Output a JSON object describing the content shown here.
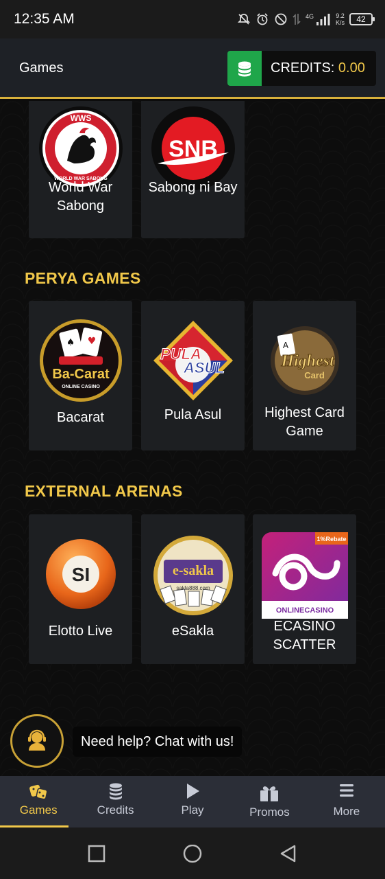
{
  "status_bar": {
    "time": "12:35 AM",
    "network_type": "4G",
    "net_speed_value": "9.2",
    "net_speed_unit": "K/s",
    "battery": "42"
  },
  "header": {
    "title": "Games",
    "credits_label": "CREDITS: ",
    "credits_value": "0.00"
  },
  "sections": {
    "top_games": [
      {
        "label": "World War Sabong",
        "logo_text": "WWS",
        "logo_sub": "WORLD WAR SABONG"
      },
      {
        "label": "Sabong ni Bay",
        "logo_text": "SNB"
      }
    ],
    "perya": {
      "title": "PERYA GAMES",
      "games": [
        {
          "label": "Bacarat",
          "logo_text": "Ba-Carat",
          "logo_sub": "ONLINE CASINO"
        },
        {
          "label": "Pula Asul",
          "logo_text": "PULA",
          "logo_text2": "ASUL"
        },
        {
          "label": "Highest Card Game",
          "logo_text": "Highest",
          "logo_sub": "Card"
        }
      ]
    },
    "external": {
      "title": "EXTERNAL ARENAS",
      "games": [
        {
          "label": "Elotto Live",
          "logo_text": "SI"
        },
        {
          "label": "eSakla",
          "logo_text": "e-sakla",
          "logo_sub": "sakla888.com"
        },
        {
          "label": "ECASINO SCATTER",
          "logo_text": "ONLINECASINO",
          "logo_badge": "1%Rebate"
        }
      ]
    }
  },
  "chat": {
    "prompt": "Need help? Chat with us!"
  },
  "bottom_nav": [
    {
      "label": "Games",
      "icon": "dice-icon",
      "active": true
    },
    {
      "label": "Credits",
      "icon": "coins-icon",
      "active": false
    },
    {
      "label": "Play",
      "icon": "play-icon",
      "active": false
    },
    {
      "label": "Promos",
      "icon": "gift-icon",
      "active": false
    },
    {
      "label": "More",
      "icon": "menu-icon",
      "active": false
    }
  ],
  "colors": {
    "accent_gold": "#f1c84a",
    "credits_green": "#1fa64a",
    "card_bg": "#1d1f22",
    "nav_bg": "#2b2e37"
  }
}
